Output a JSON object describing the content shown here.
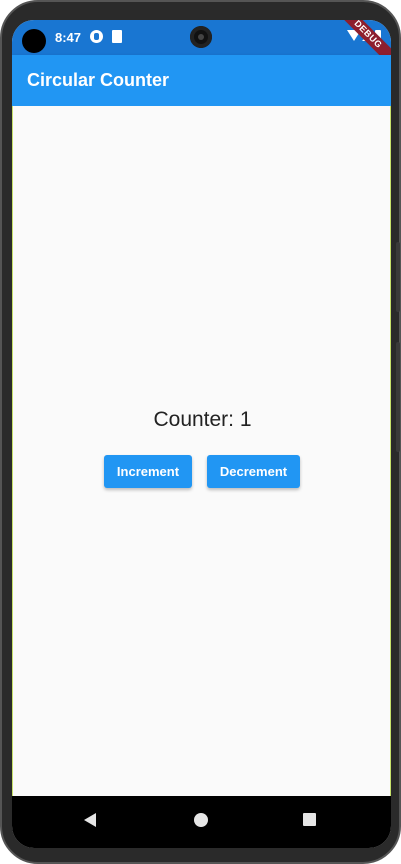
{
  "status_bar": {
    "time": "8:47",
    "icons": [
      "app-notification-icon",
      "sd-card-icon",
      "wifi-icon",
      "signal-icon",
      "battery-icon"
    ],
    "debug_banner": "DEBUG"
  },
  "app_bar": {
    "title": "Circular Counter",
    "color": "#2196f3"
  },
  "main": {
    "counter_text": "Counter: 1",
    "increment_label": "Increment",
    "decrement_label": "Decrement"
  },
  "nav_bar": {
    "icons": [
      "back-icon",
      "home-icon",
      "recents-icon"
    ]
  }
}
